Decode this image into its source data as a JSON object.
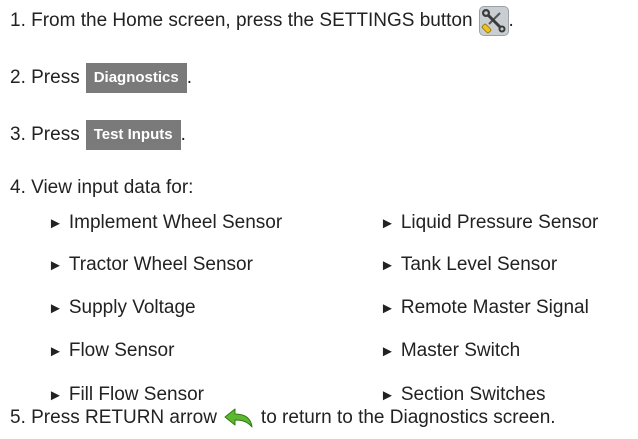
{
  "steps": {
    "s1": {
      "before": "1. From the Home screen, press the SETTINGS button",
      "after": "."
    },
    "s2": {
      "before": "2. Press",
      "button": "Diagnostics",
      "after": "."
    },
    "s3": {
      "before": "3. Press",
      "button": "Test Inputs",
      "after": "."
    },
    "s4": {
      "text": "4. View input data for:"
    },
    "s5": {
      "before": "5. Press RETURN arrow",
      "after": "to return to the Diagnostics screen."
    }
  },
  "bullet_glyph": "►",
  "inputs_left": [
    "Implement Wheel Sensor",
    "Tractor Wheel Sensor",
    "Supply Voltage",
    "Flow Sensor",
    "Fill Flow Sensor"
  ],
  "inputs_right": [
    "Liquid Pressure Sensor",
    "Tank Level Sensor",
    "Remote Master Signal",
    "Master Switch",
    "Section Switches"
  ],
  "icons": {
    "settings": "settings-tools-icon",
    "return": "return-arrow-icon"
  },
  "colors": {
    "button_bg": "#7a7a7a",
    "button_text": "#ffffff",
    "return_arrow": "#5cb82e",
    "body_text": "#222222"
  }
}
